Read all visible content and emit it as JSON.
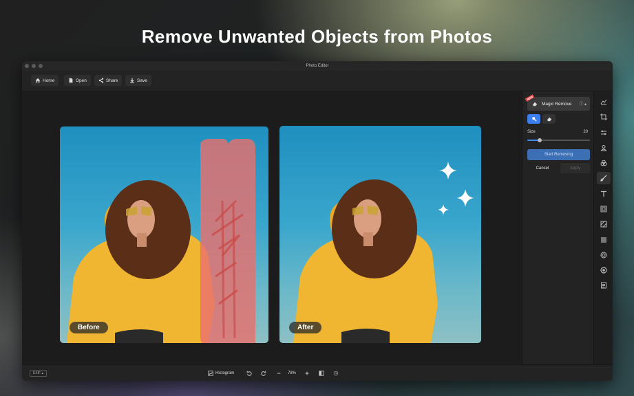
{
  "headline": "Remove Unwanted Objects from Photos",
  "window": {
    "title": "Photo Editor"
  },
  "toolbar": {
    "home_label": "Home",
    "open_label": "Open",
    "share_label": "Share",
    "save_label": "Save"
  },
  "canvas": {
    "before_label": "Before",
    "after_label": "After"
  },
  "panel": {
    "tool_name": "Magic Remove",
    "new_badge": "NEW",
    "size_label": "Size",
    "size_value": "20",
    "size_fraction": 0.2,
    "start_label": "Start Removing",
    "cancel_label": "Cancel",
    "apply_label": "Apply"
  },
  "statusbar": {
    "exif_label": "EXIF ▴",
    "histogram_label": "Histogram",
    "zoom_value": "78%"
  },
  "colors": {
    "accent": "#3d8bf0",
    "start_button": "#3d6fb5",
    "mask": "#e8706e"
  },
  "icons": {
    "toolbar": [
      "home-icon",
      "open-file-icon",
      "share-icon",
      "save-icon"
    ],
    "sidebar": [
      "adjust-icon",
      "crop-icon",
      "sliders-icon",
      "portrait-icon",
      "color-icon",
      "brush-icon",
      "text-icon",
      "frame-icon",
      "texture-icon",
      "mosaic-icon",
      "vignette-icon",
      "lens-icon",
      "notes-icon"
    ]
  }
}
